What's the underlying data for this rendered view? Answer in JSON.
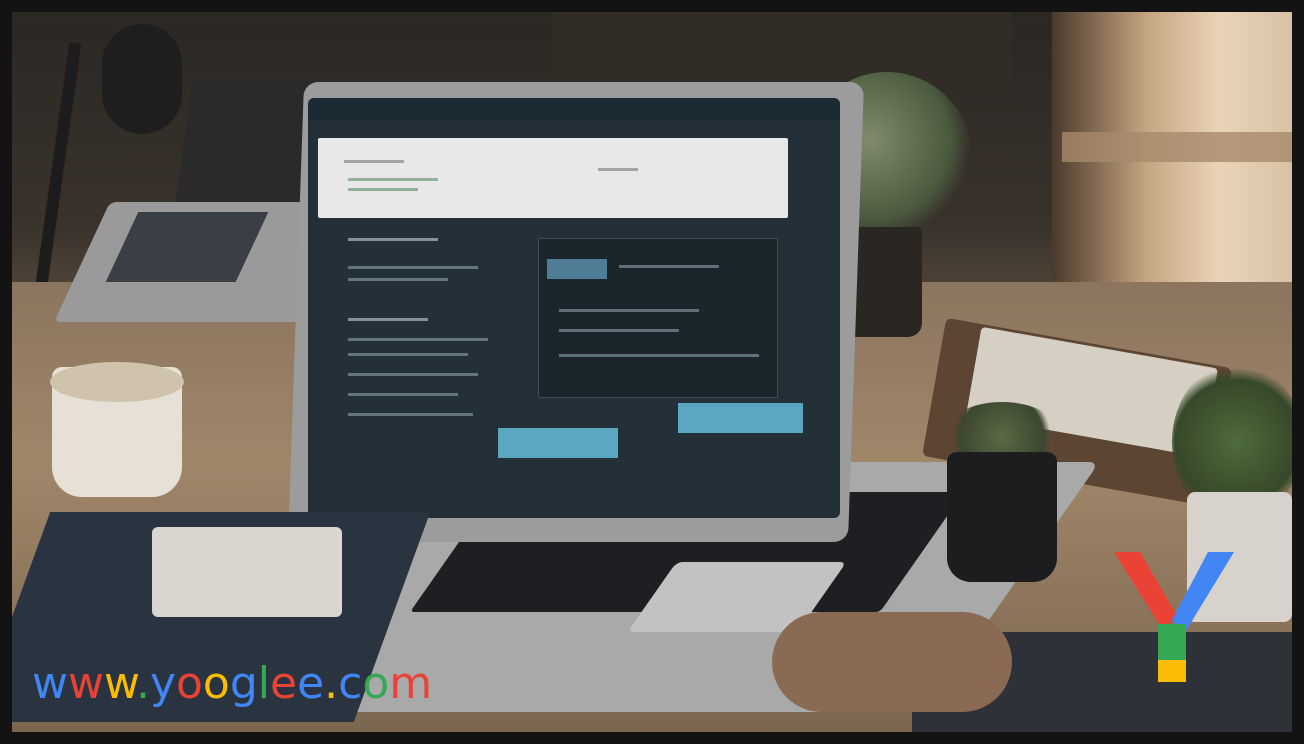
{
  "watermark": {
    "letters": [
      "w",
      "w",
      "w",
      ".",
      "y",
      "o",
      "o",
      "g",
      "l",
      "e",
      "e",
      ".",
      "c",
      "o",
      "m"
    ],
    "colors": [
      "#4285F4",
      "#EA4335",
      "#FBBC05",
      "#34A853",
      "#4285F4",
      "#EA4335",
      "#FBBC05",
      "#4285F4",
      "#34A853",
      "#EA4335",
      "#4285F4",
      "#FBBC05",
      "#4285F4",
      "#34A853",
      "#EA4335"
    ]
  },
  "logo": {
    "icon": "y-logo-icon",
    "colors": {
      "red": "#EA4335",
      "blue": "#4285F4",
      "green": "#34A853",
      "yellow": "#FBBC05"
    }
  },
  "scene": {
    "subject": "laptop-on-desk"
  }
}
